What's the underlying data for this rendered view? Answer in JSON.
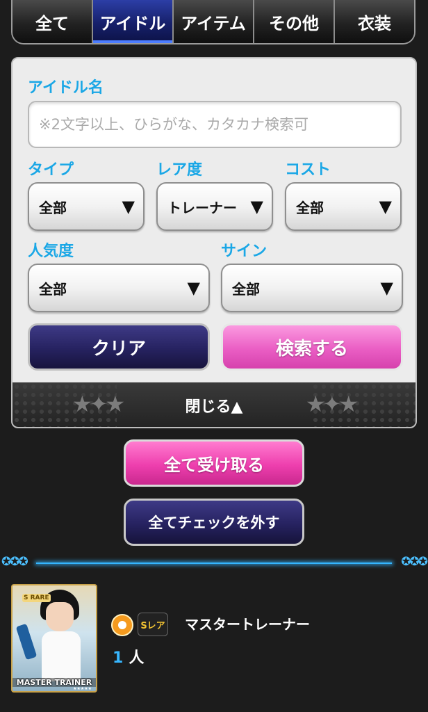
{
  "tabs": [
    {
      "label": "全て",
      "active": false
    },
    {
      "label": "アイドル",
      "active": true
    },
    {
      "label": "アイテム",
      "active": false
    },
    {
      "label": "その他",
      "active": false
    },
    {
      "label": "衣装",
      "active": false
    }
  ],
  "search": {
    "idol_name_label": "アイドル名",
    "idol_name_placeholder": "※2文字以上、ひらがな、カタカナ検索可",
    "type_label": "タイプ",
    "type_value": "全部",
    "rarity_label": "レア度",
    "rarity_value": "トレーナー",
    "cost_label": "コスト",
    "cost_value": "全部",
    "popularity_label": "人気度",
    "popularity_value": "全部",
    "sign_label": "サイン",
    "sign_value": "全部",
    "dropdown_arrow": "▼",
    "clear_label": "クリア",
    "search_label": "検索する",
    "close_label": "閉じる▲"
  },
  "actions": {
    "receive_all_label": "全て受け取る",
    "uncheck_all_label": "全てチェックを外す"
  },
  "divider": {
    "stars_left": "✪✪✪",
    "stars_right": "✪✪✪"
  },
  "entry": {
    "card_rarity_text": "S RARE",
    "card_name": "MASTER TRAINER",
    "card_stars": "★★★★★",
    "rarity_badge": "Sレア",
    "idol_name": "マスタートレーナー",
    "count": "1",
    "count_unit": "人"
  },
  "colors": {
    "accent_blue": "#1aa7e6",
    "pink": "#ee3fae",
    "navy": "#262260"
  }
}
